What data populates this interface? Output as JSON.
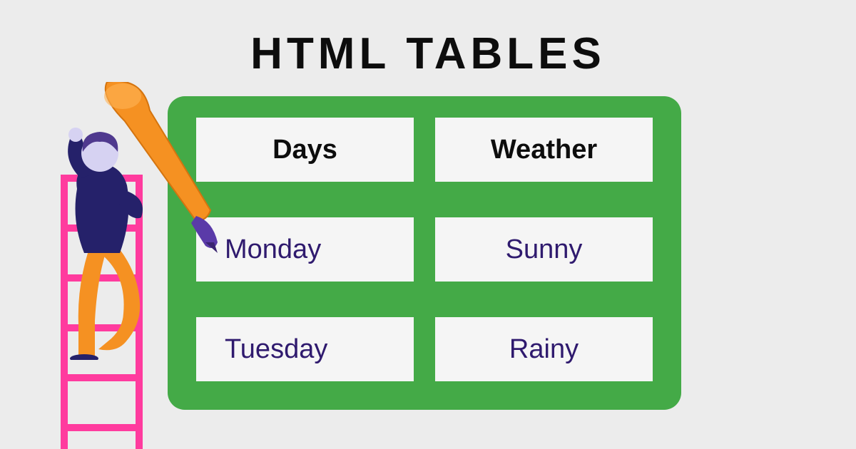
{
  "title": "HTML TABLES",
  "table": {
    "headers": [
      "Days",
      "Weather"
    ],
    "rows": [
      [
        "Monday",
        "Sunny"
      ],
      [
        "Tuesday",
        "Rainy"
      ]
    ]
  },
  "colors": {
    "background": "#ececec",
    "card": "#44aa47",
    "cell": "#f5f5f5",
    "data_text": "#2f1a6e",
    "ladder": "#ff3b9e",
    "pencil_body": "#f59122",
    "pencil_tip": "#5a3aa8",
    "person_body": "#25216a",
    "person_legs": "#f59122",
    "person_face": "#d6d2f2",
    "person_hair": "#4f398e"
  }
}
